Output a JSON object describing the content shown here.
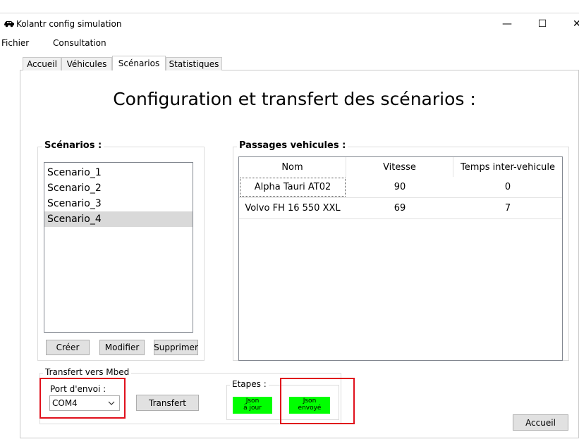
{
  "window": {
    "title": "Kolantr config simulation",
    "minimize_glyph": "—",
    "maximize_glyph": "☐",
    "close_glyph": "✕",
    "icon": "car-icon"
  },
  "menu": {
    "items": [
      "Fichier",
      "Consultation"
    ]
  },
  "tabs": [
    {
      "label": "Accueil"
    },
    {
      "label": "Véhicules"
    },
    {
      "label": "Scénarios",
      "active": true
    },
    {
      "label": "Statistiques"
    }
  ],
  "page": {
    "title": "Configuration et transfert des scénarios :"
  },
  "scenarios": {
    "group_label": "Scénarios :",
    "items": [
      "Scenario_1",
      "Scenario_2",
      "Scenario_3",
      "Scenario_4"
    ],
    "selected_index": 3,
    "buttons": {
      "create": "Créer",
      "modify": "Modifier",
      "delete": "Supprimer"
    }
  },
  "passages": {
    "group_label": "Passages vehicules :",
    "columns": [
      "Nom",
      "Vitesse",
      "Temps inter-vehicule"
    ],
    "rows": [
      {
        "nom": "Alpha Tauri AT02",
        "vitesse": "90",
        "temps": "0"
      },
      {
        "nom": "Volvo FH 16 550 XXL",
        "vitesse": "69",
        "temps": "7"
      }
    ]
  },
  "transfert": {
    "group_label": "Transfert vers Mbed",
    "port_label": "Port d'envoi :",
    "port_value": "COM4",
    "transfer_button": "Transfert",
    "steps_label": "Etapes :",
    "step1_line1": "Json",
    "step1_line2": "à jour",
    "step2_line1": "Json",
    "step2_line2": "envoyé"
  },
  "footer": {
    "home_button": "Accueil"
  },
  "colors": {
    "step_ok": "#00ff00",
    "highlight": "#e0101c",
    "selection": "#d9d9d9"
  }
}
